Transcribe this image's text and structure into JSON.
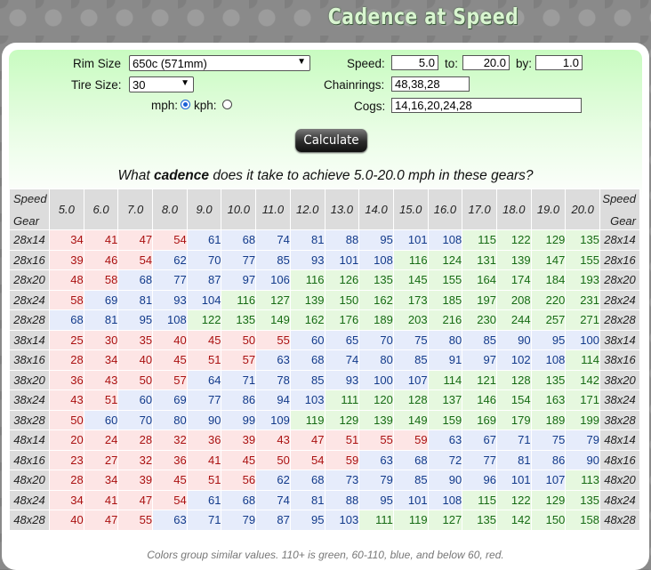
{
  "title": "Cadence at Speed",
  "form": {
    "rim_label": "Rim Size",
    "rim_value": "650c (571mm)",
    "tire_label": "Tire Size:",
    "tire_value": "30",
    "mph_label": "mph:",
    "kph_label": "kph:",
    "units_selected": "mph",
    "speed_label": "Speed:",
    "speed_from": "5.0",
    "to_label": "to:",
    "speed_to": "20.0",
    "by_label": "by:",
    "speed_by": "1.0",
    "chainrings_label": "Chainrings:",
    "chainrings_value": "48,38,28",
    "cogs_label": "Cogs:",
    "cogs_value": "14,16,20,24,28",
    "calculate_label": "Calculate"
  },
  "question": {
    "prefix": "What ",
    "bold": "cadence",
    "suffix": " does it take to achieve 5.0-20.0 mph in these gears?"
  },
  "table": {
    "speed_header": "Speed",
    "gear_header": "Gear",
    "speeds": [
      "5.0",
      "6.0",
      "7.0",
      "8.0",
      "9.0",
      "10.0",
      "11.0",
      "12.0",
      "13.0",
      "14.0",
      "15.0",
      "16.0",
      "17.0",
      "18.0",
      "19.0",
      "20.0"
    ],
    "rows": [
      {
        "gear": "28x14",
        "values": [
          34,
          41,
          47,
          54,
          61,
          68,
          74,
          81,
          88,
          95,
          101,
          108,
          115,
          122,
          129,
          135
        ]
      },
      {
        "gear": "28x16",
        "values": [
          39,
          46,
          54,
          62,
          70,
          77,
          85,
          93,
          101,
          108,
          116,
          124,
          131,
          139,
          147,
          155
        ]
      },
      {
        "gear": "28x20",
        "values": [
          48,
          58,
          68,
          77,
          87,
          97,
          106,
          116,
          126,
          135,
          145,
          155,
          164,
          174,
          184,
          193
        ]
      },
      {
        "gear": "28x24",
        "values": [
          58,
          69,
          81,
          93,
          104,
          116,
          127,
          139,
          150,
          162,
          173,
          185,
          197,
          208,
          220,
          231
        ]
      },
      {
        "gear": "28x28",
        "values": [
          68,
          81,
          95,
          108,
          122,
          135,
          149,
          162,
          176,
          189,
          203,
          216,
          230,
          244,
          257,
          271
        ]
      },
      {
        "gear": "38x14",
        "values": [
          25,
          30,
          35,
          40,
          45,
          50,
          55,
          60,
          65,
          70,
          75,
          80,
          85,
          90,
          95,
          100
        ]
      },
      {
        "gear": "38x16",
        "values": [
          28,
          34,
          40,
          45,
          51,
          57,
          63,
          68,
          74,
          80,
          85,
          91,
          97,
          102,
          108,
          114
        ]
      },
      {
        "gear": "38x20",
        "values": [
          36,
          43,
          50,
          57,
          64,
          71,
          78,
          85,
          93,
          100,
          107,
          114,
          121,
          128,
          135,
          142
        ]
      },
      {
        "gear": "38x24",
        "values": [
          43,
          51,
          60,
          69,
          77,
          86,
          94,
          103,
          111,
          120,
          128,
          137,
          146,
          154,
          163,
          171
        ]
      },
      {
        "gear": "38x28",
        "values": [
          50,
          60,
          70,
          80,
          90,
          99,
          109,
          119,
          129,
          139,
          149,
          159,
          169,
          179,
          189,
          199
        ]
      },
      {
        "gear": "48x14",
        "values": [
          20,
          24,
          28,
          32,
          36,
          39,
          43,
          47,
          51,
          55,
          59,
          63,
          67,
          71,
          75,
          79
        ]
      },
      {
        "gear": "48x16",
        "values": [
          23,
          27,
          32,
          36,
          41,
          45,
          50,
          54,
          59,
          63,
          68,
          72,
          77,
          81,
          86,
          90
        ]
      },
      {
        "gear": "48x20",
        "values": [
          28,
          34,
          39,
          45,
          51,
          56,
          62,
          68,
          73,
          79,
          85,
          90,
          96,
          101,
          107,
          113
        ]
      },
      {
        "gear": "48x24",
        "values": [
          34,
          41,
          47,
          54,
          61,
          68,
          74,
          81,
          88,
          95,
          101,
          108,
          115,
          122,
          129,
          135
        ]
      },
      {
        "gear": "48x28",
        "values": [
          40,
          47,
          55,
          63,
          71,
          79,
          87,
          95,
          103,
          111,
          119,
          127,
          135,
          142,
          150,
          158
        ]
      }
    ]
  },
  "footer": "Colors group similar values. 110+ is green, 60-110, blue, and below 60, red.",
  "colors": {
    "red_bg": "#fde5e5",
    "blue_bg": "#e6ecfb",
    "green_bg": "#e6f8df",
    "header_bg": "#dcdcdc",
    "form_bg": "#c8fbc0"
  }
}
